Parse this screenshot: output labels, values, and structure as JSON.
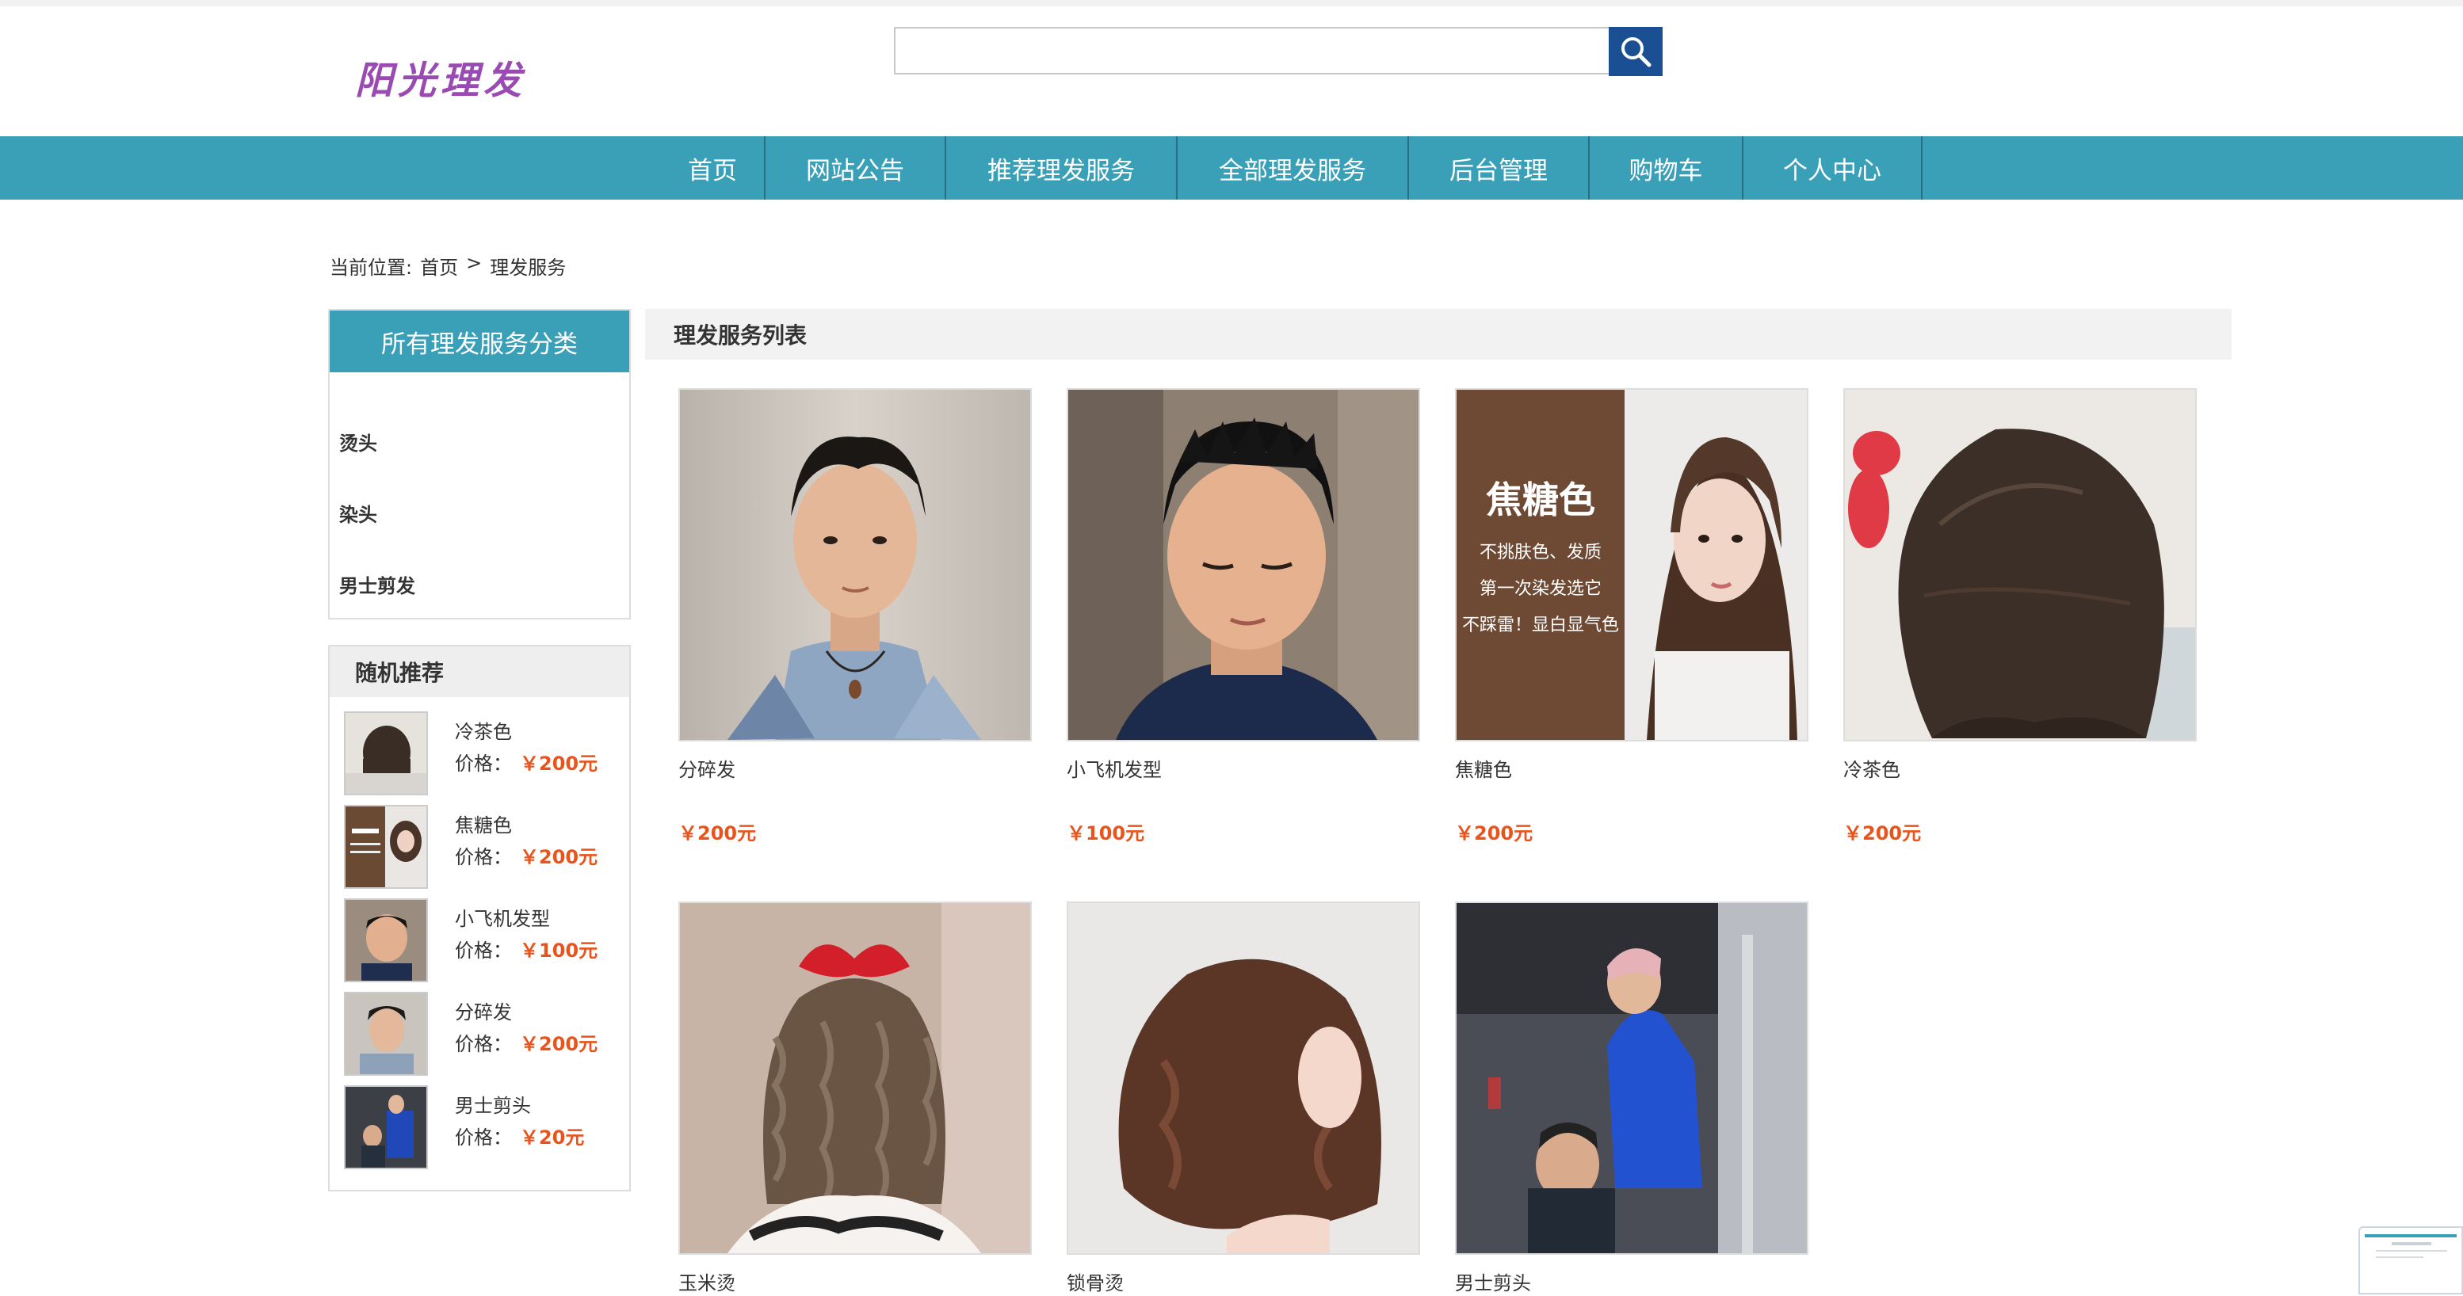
{
  "header": {
    "logo_text": "阳光理发",
    "search_placeholder": ""
  },
  "nav": {
    "items": [
      {
        "label": "首页"
      },
      {
        "label": "网站公告"
      },
      {
        "label": "推荐理发服务"
      },
      {
        "label": "全部理发服务"
      },
      {
        "label": "后台管理"
      },
      {
        "label": "购物车"
      },
      {
        "label": "个人中心"
      }
    ]
  },
  "breadcrumb": {
    "prefix": "当前位置:",
    "home": "首页",
    "sep": ">",
    "current": "理发服务"
  },
  "categories": {
    "title": "所有理发服务分类",
    "items": [
      "烫头",
      "染头",
      "男士剪发"
    ]
  },
  "recommend": {
    "title": "随机推荐",
    "price_label": "价格：",
    "items": [
      {
        "name": "冷茶色",
        "price": "￥200元",
        "image": "bob-hair-photo"
      },
      {
        "name": "焦糖色",
        "price": "￥200元",
        "image": "caramel-color-photo"
      },
      {
        "name": "小飞机发型",
        "price": "￥100元",
        "image": "short-men-haircut-photo"
      },
      {
        "name": "分碎发",
        "price": "￥200元",
        "image": "men-textured-hair-photo"
      },
      {
        "name": "男士剪头",
        "price": "￥20元",
        "image": "barber-cutting-photo"
      }
    ]
  },
  "main": {
    "list_title": "理发服务列表",
    "products": [
      {
        "name": "分碎发",
        "price": "￥200元",
        "image": "men-textured-hair-photo"
      },
      {
        "name": "小飞机发型",
        "price": "￥100元",
        "image": "short-men-haircut-photo"
      },
      {
        "name": "焦糖色",
        "price": "￥200元",
        "image": "caramel-color-photo",
        "overlay": {
          "title": "焦糖色",
          "lines": [
            "不挑肤色、发质",
            "第一次染发选它",
            "不踩雷！显白显气色"
          ]
        }
      },
      {
        "name": "冷茶色",
        "price": "￥200元",
        "image": "bob-hair-photo"
      },
      {
        "name": "玉米烫",
        "price": "",
        "image": "corn-perm-photo"
      },
      {
        "name": "锁骨烫",
        "price": "",
        "image": "collarbone-perm-photo"
      },
      {
        "name": "男士剪头",
        "price": "",
        "image": "barber-cutting-photo"
      }
    ]
  },
  "colors": {
    "nav_bg": "#3aa0b8",
    "price": "#e8541c",
    "logo": "#9a4bb1",
    "search_button": "#1b4f93"
  }
}
